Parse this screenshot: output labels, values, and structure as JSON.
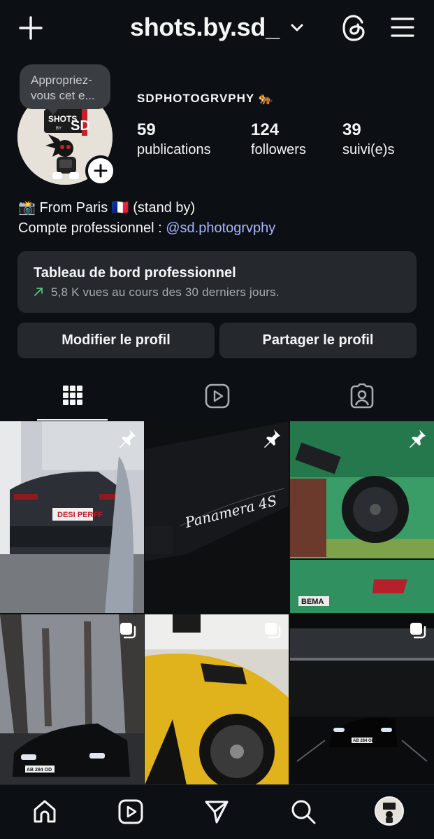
{
  "header": {
    "username": "shots.by.sd_",
    "icons": [
      "plus-icon",
      "chevron-down-icon",
      "threads-icon",
      "menu-icon"
    ]
  },
  "profile": {
    "tooltip": "Appropriez-vous cet e...",
    "tooltip_line1": "Appropriez-",
    "tooltip_line2": "vous cet e...",
    "logo_text_top": "SHOTS",
    "logo_text_by": "BY",
    "logo_text_sd": "SD",
    "display_name": "SDPHOTOGRVPHY 🐅",
    "stats": [
      {
        "value": "59",
        "label": "publications"
      },
      {
        "value": "124",
        "label": "followers"
      },
      {
        "value": "39",
        "label": "suivi(e)s"
      }
    ],
    "bio_line1": "📸 From Paris 🇫🇷 (stand by)",
    "bio_line2_prefix": "Compte professionnel : ",
    "bio_link": "@sd.photogrvphy"
  },
  "dashboard": {
    "title": "Tableau de bord professionnel",
    "subtitle": "5,8 K vues au cours des 30 derniers jours.",
    "trend_icon": "arrow-up-right-icon"
  },
  "buttons": {
    "edit": "Modifier le profil",
    "share": "Partager le profil"
  },
  "tabs": [
    {
      "name": "grid",
      "icon": "grid-icon",
      "active": true
    },
    {
      "name": "reels",
      "icon": "reels-icon",
      "active": false
    },
    {
      "name": "tagged",
      "icon": "tagged-icon",
      "active": false
    }
  ],
  "grid": [
    {
      "type": "pinned",
      "plate": "DESI PERFF"
    },
    {
      "type": "pinned",
      "script": "Panamera 4S"
    },
    {
      "type": "pinned",
      "plate": "BEMA"
    },
    {
      "type": "carousel",
      "plate": "AB 284 OD"
    },
    {
      "type": "carousel"
    },
    {
      "type": "carousel",
      "plate": "AB 284 OD"
    }
  ],
  "bottom_nav": [
    "home-icon",
    "reels-icon",
    "direct-icon",
    "search-icon",
    "profile-avatar"
  ],
  "colors": {
    "background": "#0c1014",
    "card": "#25292e",
    "link": "#a8b4ff",
    "trend": "#58c27d",
    "text": "#f5f5f5"
  }
}
